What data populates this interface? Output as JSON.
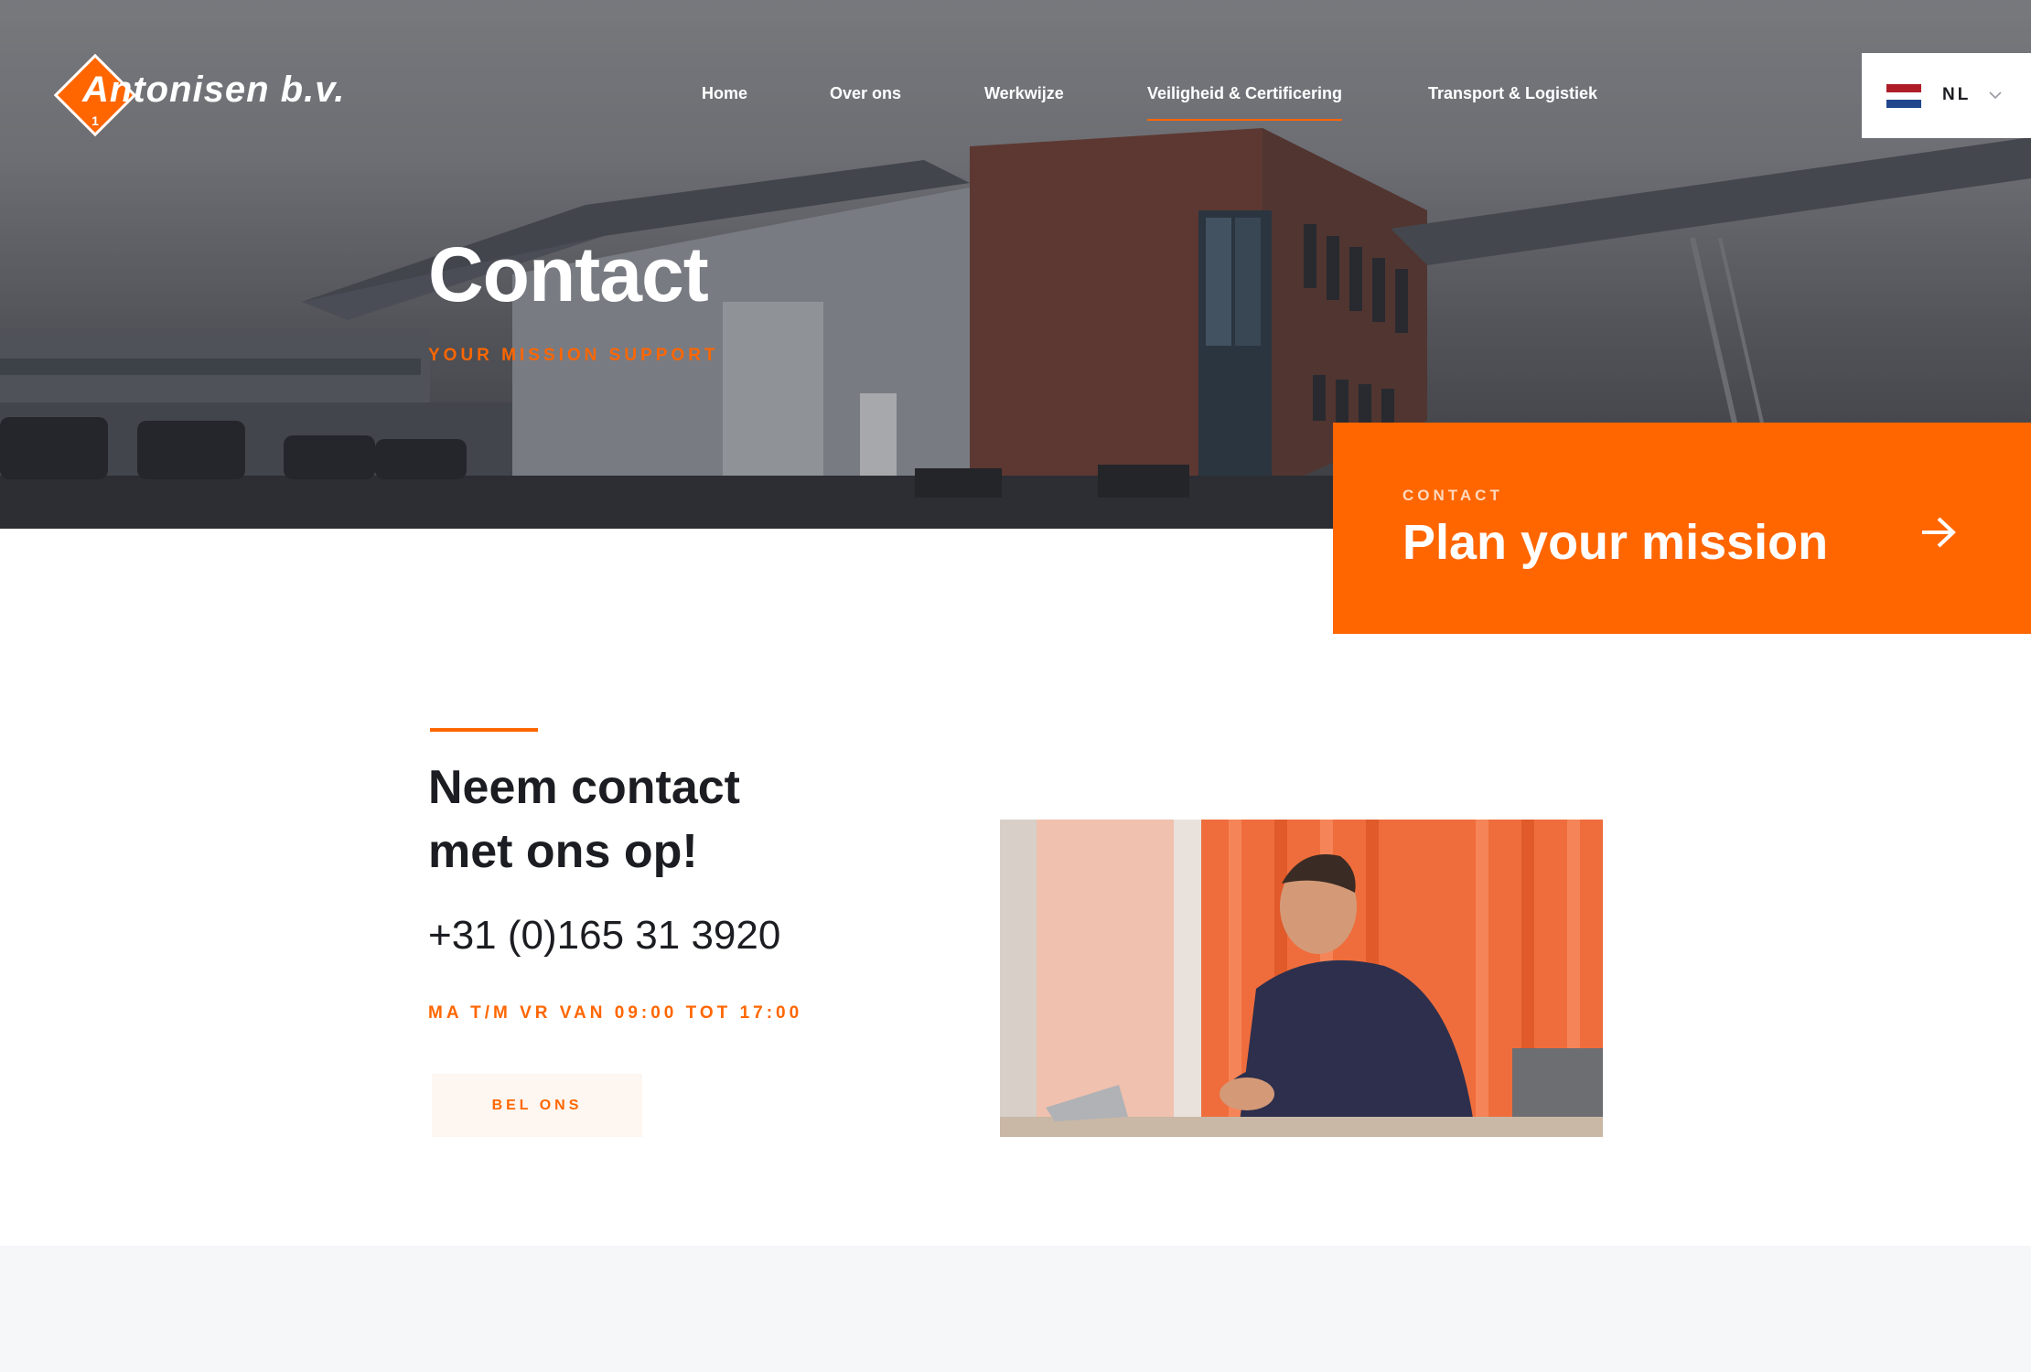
{
  "brand": {
    "logo_text": "Antonisen b.v.",
    "logo_number": "1",
    "accent_color": "#ff6600"
  },
  "nav": {
    "items": [
      {
        "label": "Home"
      },
      {
        "label": "Over ons"
      },
      {
        "label": "Werkwijze"
      },
      {
        "label": "Veiligheid & Certificering",
        "active": true
      },
      {
        "label": "Transport & Logistiek"
      }
    ]
  },
  "language": {
    "code": "NL",
    "flag": "netherlands-flag-icon"
  },
  "hero": {
    "title": "Contact",
    "subtitle": "YOUR MISSION SUPPORT"
  },
  "cta": {
    "eyebrow": "CONTACT",
    "title": "Plan your mission",
    "icon": "arrow-right-icon"
  },
  "contact": {
    "title_line1": "Neem contact",
    "title_line2": "met ons op!",
    "phone": "+31 (0)165 31 3920",
    "hours": "MA T/M VR VAN 09:00 TOT 17:00",
    "button_label": "BEL ONS"
  }
}
